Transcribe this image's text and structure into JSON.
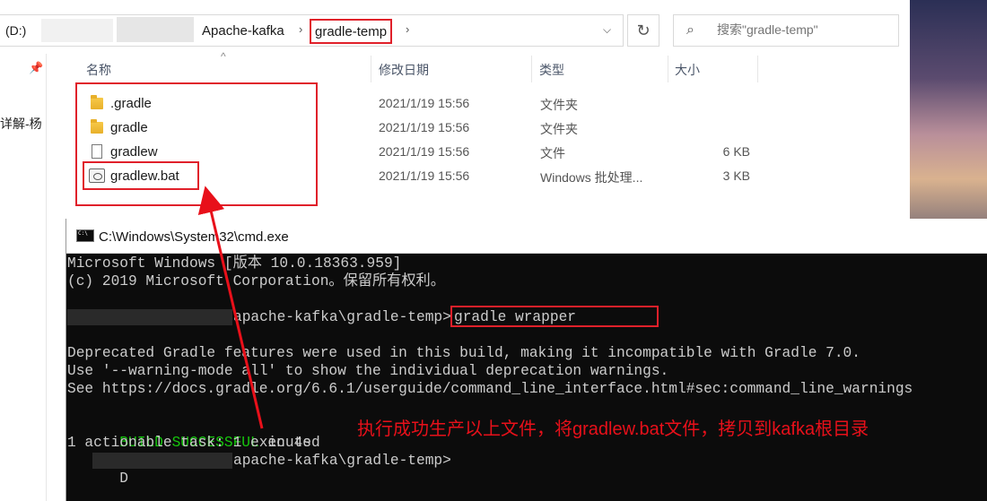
{
  "explorer": {
    "left_pane_cut_text": "详解-杨",
    "address": {
      "drive": "(D:)",
      "crumb_parent": "Apache-kafka",
      "crumb_current": "gradle-temp"
    },
    "search_placeholder": "搜索\"gradle-temp\"",
    "columns": {
      "name": "名称",
      "date": "修改日期",
      "type": "类型",
      "size": "大小"
    },
    "files": [
      {
        "name": ".gradle",
        "date": "2021/1/19 15:56",
        "type": "文件夹",
        "size": "",
        "icon": "folder-icon"
      },
      {
        "name": "gradle",
        "date": "2021/1/19 15:56",
        "type": "文件夹",
        "size": "",
        "icon": "folder-icon"
      },
      {
        "name": "gradlew",
        "date": "2021/1/19 15:56",
        "type": "文件",
        "size": "6 KB",
        "icon": "file-icon"
      },
      {
        "name": "gradlew.bat",
        "date": "2021/1/19 15:56",
        "type": "Windows 批处理...",
        "size": "3 KB",
        "icon": "batch-file-icon"
      }
    ]
  },
  "cmd": {
    "title": "C:\\Windows\\System32\\cmd.exe",
    "lines": {
      "l1": "Microsoft Windows [版本 10.0.18363.959]",
      "l2": "(c) 2019 Microsoft Corporation。保留所有权利。",
      "l3_path": "apache-kafka\\gradle-temp>",
      "l3_cmd": "gradle wrapper",
      "l4": "Deprecated Gradle features were used in this build, making it incompatible with Gradle 7.0.",
      "l5": "Use '--warning-mode all' to show the individual deprecation warnings.",
      "l6": "See https://docs.gradle.org/6.6.1/userguide/command_line_interface.html#sec:command_line_warnings",
      "l7_success": "BUILD SUCCESSFUL",
      "l7_rest": " in 4s",
      "l8": "1 actionable task: 1 executed",
      "l9_drive": "D",
      "l9_path": "apache-kafka\\gradle-temp>"
    }
  },
  "annotation": "执行成功生产以上文件，将gradlew.bat文件，拷贝到kafka根目录",
  "colors": {
    "highlight": "#e0202a",
    "success": "#16c60c"
  }
}
